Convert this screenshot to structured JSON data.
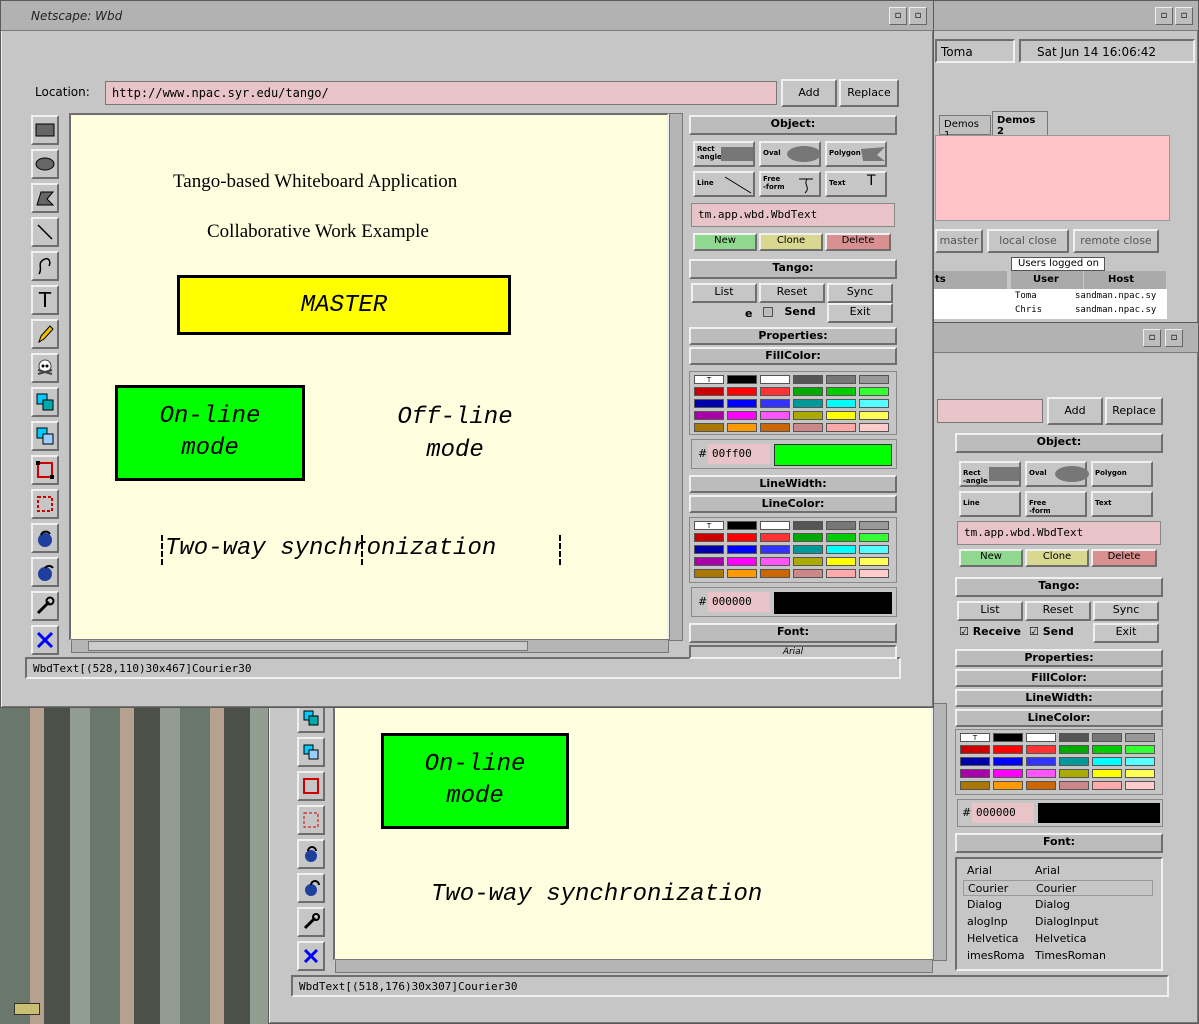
{
  "window_title": "Netscape: Wbd",
  "location_label": "Location:",
  "url": "http://www.npac.syr.edu/tango/",
  "add_label": "Add",
  "replace_label": "Replace",
  "canvas": {
    "title1": "Tango-based Whiteboard Application",
    "title2": "Collaborative Work Example",
    "master": "MASTER",
    "online_1": "On-line",
    "online_2": "mode",
    "offline_1": "Off-line",
    "offline_2": "mode",
    "sync": "Two-way synchronization"
  },
  "status_main": "WbdText[(528,110)30x467]Courier30",
  "status_second": "WbdText[(518,176)30x307]Courier30",
  "panel": {
    "object_hdr": "Object:",
    "rect": "Rect\n-angle",
    "oval": "Oval",
    "polygon": "Polygon",
    "line": "Line",
    "freeform": "Free\n-form",
    "text": "Text",
    "text_glyph": "T",
    "class_value": "tm.app.wbd.WbdText",
    "new": "New",
    "clone": "Clone",
    "delete": "Delete",
    "tango_hdr": "Tango:",
    "list": "List",
    "reset": "Reset",
    "sync": "Sync",
    "receive": "Receive",
    "send": "Send",
    "exit": "Exit",
    "properties_hdr": "Properties:",
    "fillcolor_hdr": "FillColor:",
    "linewidth_hdr": "LineWidth:",
    "linecolor_hdr": "LineColor:",
    "font_hdr": "Font:",
    "fill_hex": "00ff00",
    "line_hex": "000000",
    "hash": "#",
    "swatch_first": "T"
  },
  "fonts_list": [
    {
      "left": "Arial",
      "right": "Arial"
    },
    {
      "left": "Courier",
      "right": "Courier"
    },
    {
      "left": "Dialog",
      "right": "Dialog"
    },
    {
      "left": "alogInp",
      "right": "DialogInput"
    },
    {
      "left": "Helvetica",
      "right": "Helvetica"
    },
    {
      "left": "imesRoma",
      "right": "TimesRoman"
    }
  ],
  "font_partial": "Arial",
  "back_window": {
    "user": "Toma",
    "datetime": "Sat Jun 14 16:06:42",
    "tab1": "Demos 1",
    "tab2": "Demos 2",
    "btn_master": "master",
    "btn_local_close": "local close",
    "btn_remote_close": "remote close",
    "users_logged_on": "Users logged on",
    "col_user": "User",
    "col_host": "Host",
    "col_ts": "ts",
    "users": [
      {
        "user": "Toma",
        "host": "sandman.npac.sy"
      },
      {
        "user": "Chris",
        "host": "sandman.npac.sy"
      }
    ]
  },
  "colors": {
    "fill_preview": "#00ff00",
    "line_preview": "#000000",
    "master_box": "#ffff00",
    "online_box": "#00ff00",
    "canvas_bg": "#ffffe0",
    "new_btn": "#90d890",
    "clone_btn": "#d8d890",
    "delete_btn": "#d89090"
  },
  "palette": [
    [
      "#ffffff",
      "#000000",
      "#ffffff",
      "#555555",
      "#777777",
      "#999999"
    ],
    [
      "#cc0000",
      "#ff0000",
      "#ff3333",
      "#00aa00",
      "#00cc00",
      "#33ff33"
    ],
    [
      "#0000aa",
      "#0000ff",
      "#3333ff",
      "#009999",
      "#00ffff",
      "#55ffff"
    ],
    [
      "#aa00aa",
      "#ff00ff",
      "#ff55ff",
      "#aaaa00",
      "#ffff00",
      "#ffff55"
    ],
    [
      "#aa7700",
      "#ff9900",
      "#cc6600",
      "#cc8888",
      "#ffaaaa",
      "#ffcccc"
    ]
  ]
}
